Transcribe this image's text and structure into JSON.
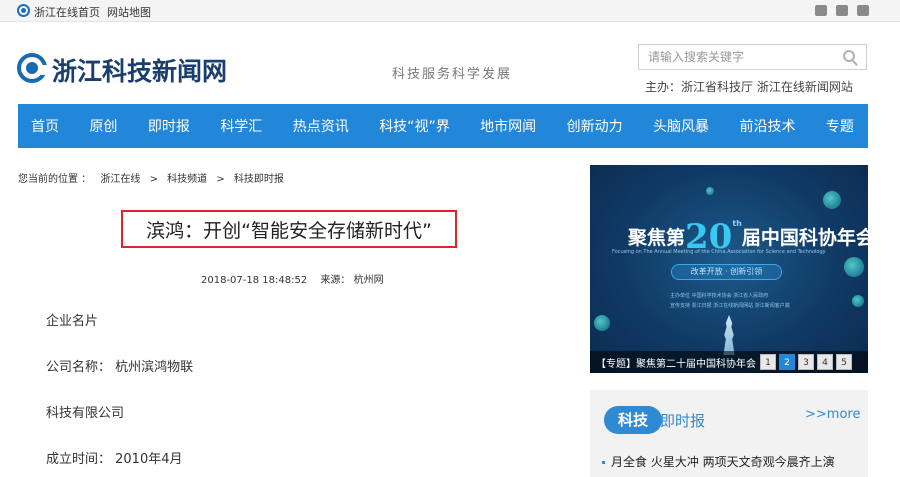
{
  "topbar": {
    "home_link": "浙江在线首页",
    "sitemap_link": "网站地图"
  },
  "header": {
    "logo_text": "浙江科技新闻网",
    "slogan": "科技服务科学发展",
    "search_placeholder": "请输入搜索关键字",
    "sponsor": "主办：浙江省科技厅 浙江在线新闻网站"
  },
  "nav": {
    "items": [
      "首页",
      "原创",
      "即时报",
      "科学汇",
      "热点资讯",
      "科技“视”界",
      "地市网闻",
      "创新动力",
      "头脑风暴",
      "前沿技术",
      "专题"
    ]
  },
  "breadcrumb": {
    "prefix": "您当前的位置 ：",
    "items": [
      "浙江在线",
      ">",
      "科技频道",
      ">",
      "科技即时报"
    ]
  },
  "article": {
    "title": "滨鸿：开创“智能安全存储新时代”",
    "date": "2018-07-18 18:48:52",
    "source": "来源： 杭州网",
    "paragraphs": [
      "企业名片",
      "公司名称： 杭州滨鸿物联",
      "科技有限公司",
      "成立时间： 2010年4月"
    ]
  },
  "banner": {
    "title_pre": "聚焦第",
    "title_num": "20",
    "title_sup": "th",
    "title_post": "届中国科协年会",
    "subtitle": "Focusing on The  Annual Meeting of the China Association for Science and Technology",
    "pill": "改革开放 · 创新引领",
    "org1": "主办单位  中国科学技术协会  浙江省人民政府",
    "org2": "宣传支持  浙江日报  浙江在线新闻网站  浙江新闻客户端",
    "caption": "【专题】聚焦第二十届中国科协年会",
    "pages": [
      "1",
      "2",
      "3",
      "4",
      "5"
    ],
    "active_page": "2"
  },
  "news": {
    "badge_a": "科技",
    "badge_b": "即时报",
    "more": ">>more",
    "items": [
      "月全食 火星大冲 两项天文奇观今晨齐上演"
    ]
  },
  "colors": {
    "brand_blue": "#2287d8",
    "title_border": "#e0242a"
  }
}
